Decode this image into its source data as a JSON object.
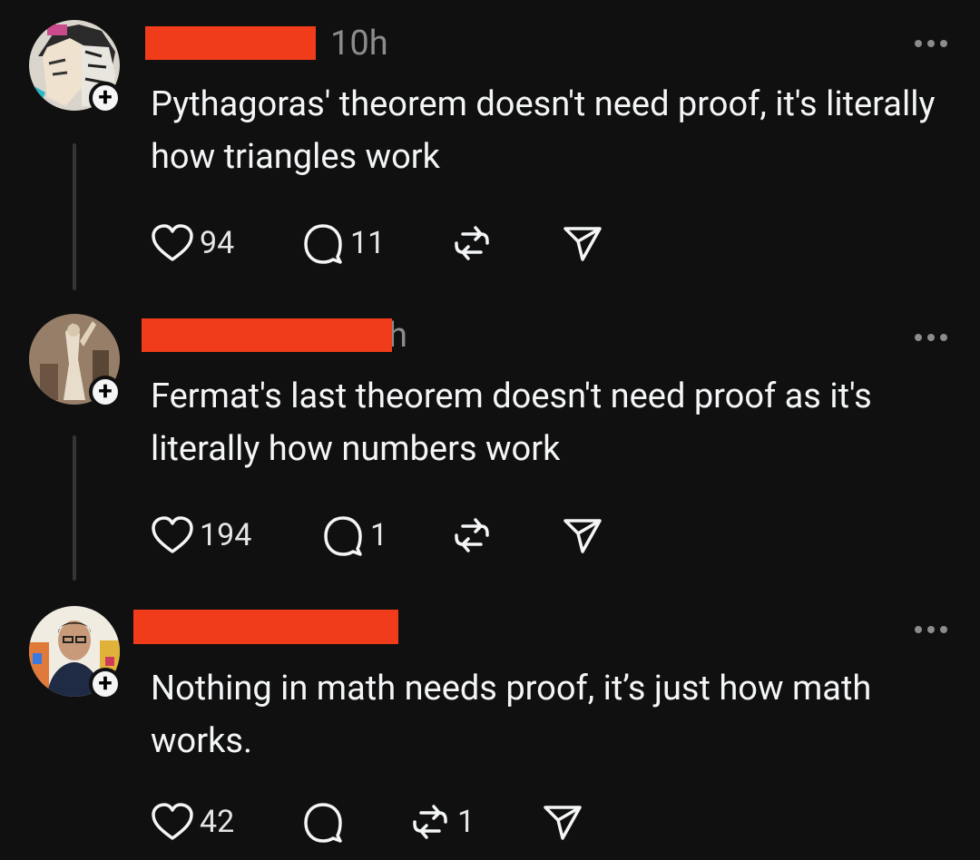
{
  "posts": [
    {
      "time": "10h",
      "text": "Pythagoras' theorem doesn't need proof, it's literally how triangles work",
      "likes": "94",
      "replies": "11",
      "reposts": "",
      "follow_glyph": "+"
    },
    {
      "time": "h",
      "text": "Fermat's last theorem doesn't need proof as it's literally how numbers work",
      "likes": "194",
      "replies": "1",
      "reposts": "",
      "follow_glyph": "+"
    },
    {
      "time": "",
      "text": "Nothing in math needs proof, it’s just how math works.",
      "likes": "42",
      "replies": "",
      "reposts": "1",
      "follow_glyph": "+"
    }
  ],
  "colors": {
    "background": "#101010",
    "redaction": "#f03c1a",
    "text": "#f3f5f7",
    "muted": "#8c8c8c"
  },
  "icons": [
    "heart-icon",
    "comment-icon",
    "repost-icon",
    "share-icon",
    "more-icon",
    "plus-icon"
  ]
}
